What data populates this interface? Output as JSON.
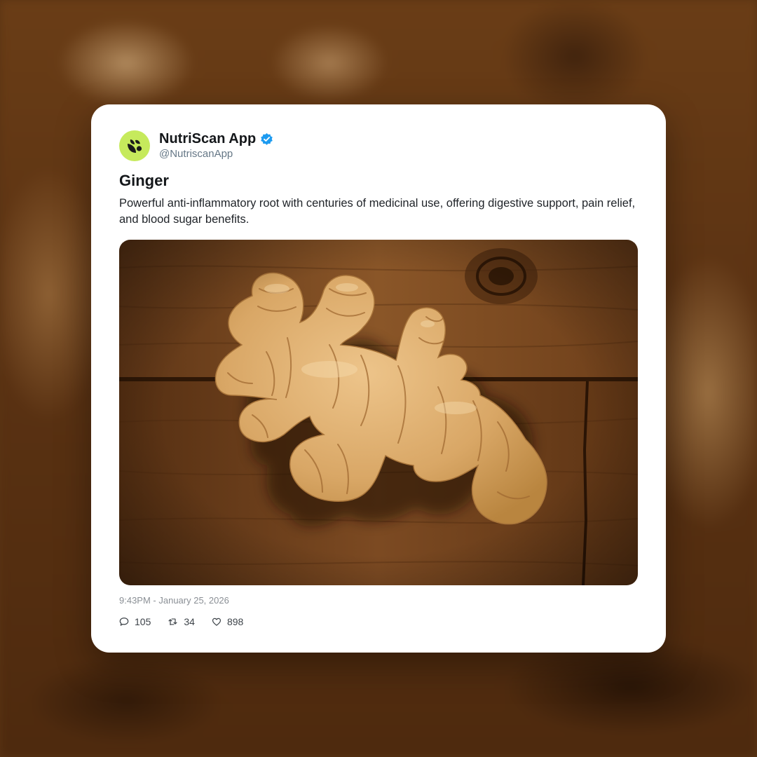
{
  "post": {
    "account_name": "NutriScan App",
    "handle": "@NutriscanApp",
    "verified": true,
    "title": "Ginger",
    "description": "Powerful anti-inflammatory root with centuries of medicinal use, offering digestive support, pain relief, and blood sugar benefits.",
    "image_subject": "ginger root on wooden table",
    "timestamp": "9:43PM - January 25, 2026",
    "stats": {
      "replies": "105",
      "retweets": "34",
      "likes": "898"
    }
  },
  "icons": {
    "avatar": "leaf-logo-icon",
    "verified": "verified-badge-icon",
    "replies": "comment-icon",
    "retweets": "retweet-icon",
    "likes": "heart-icon"
  },
  "colors": {
    "avatar_bg": "#c6ea5c",
    "verified": "#1d9bf0",
    "ginger": "#d9a766",
    "wood": "#7a4a22"
  }
}
